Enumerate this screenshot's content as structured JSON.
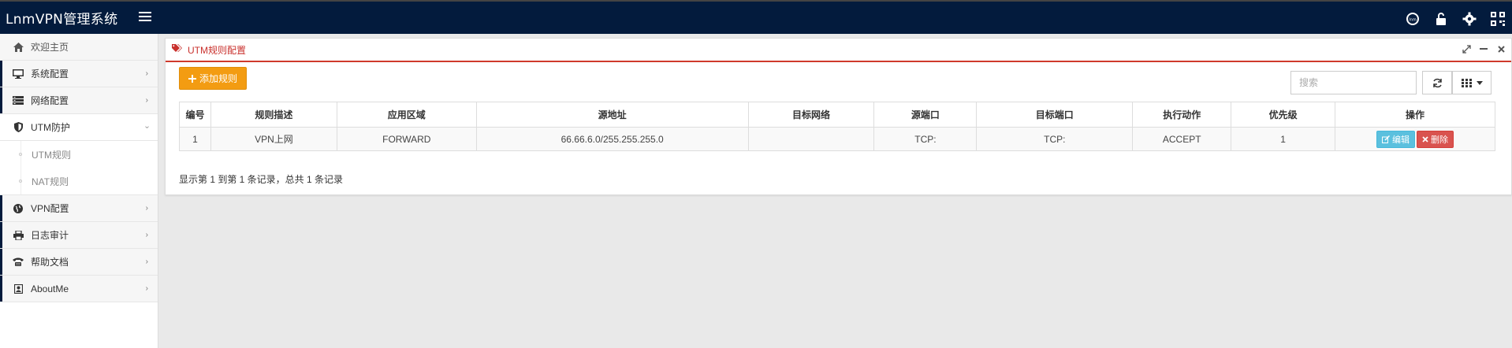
{
  "app": {
    "title": "LnmVPN管理系统"
  },
  "header_icons": [
    "user-circle-icon",
    "unlock-icon",
    "gear-icon",
    "qrcode-icon"
  ],
  "sidebar": {
    "items": [
      {
        "label": "欢迎主页",
        "icon": "home-icon"
      },
      {
        "label": "系统配置",
        "icon": "monitor-icon"
      },
      {
        "label": "网络配置",
        "icon": "server-icon"
      },
      {
        "label": "UTM防护",
        "icon": "shield-icon"
      },
      {
        "label": "VPN配置",
        "icon": "globe-icon"
      },
      {
        "label": "日志审计",
        "icon": "printer-icon"
      },
      {
        "label": "帮助文档",
        "icon": "phone-icon"
      },
      {
        "label": "AboutMe",
        "icon": "contact-card-icon"
      }
    ],
    "submenu": [
      {
        "label": "UTM规则"
      },
      {
        "label": "NAT规则"
      }
    ]
  },
  "panel": {
    "title": "UTM规则配置",
    "add_button": "添加规则",
    "search_placeholder": "搜索"
  },
  "table": {
    "headers": [
      "编号",
      "规则描述",
      "应用区域",
      "源地址",
      "目标网络",
      "源端口",
      "目标端口",
      "执行动作",
      "优先级",
      "操作"
    ],
    "rows": [
      {
        "id": "1",
        "desc": "VPN上网",
        "zone": "FORWARD",
        "src": "66.66.6.0/255.255.255.0",
        "dst": "",
        "sport": "TCP:",
        "dport": "TCP:",
        "action": "ACCEPT",
        "priority": "1"
      }
    ],
    "edit_label": "编辑",
    "delete_label": "删除"
  },
  "summary": "显示第 1 到第 1 条记录，总共 1 条记录",
  "colors": {
    "navbar": "#031b3d",
    "accent_red": "#cf3a2c",
    "add_button": "#f39c12",
    "edit_button": "#5bc0de",
    "delete_button": "#d9534f"
  }
}
